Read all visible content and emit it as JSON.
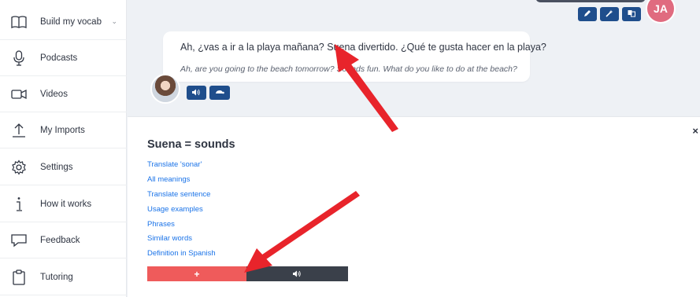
{
  "sidebar": {
    "items": [
      {
        "label": "Build my vocab",
        "icon": "book-icon"
      },
      {
        "label": "Podcasts",
        "icon": "microphone-icon"
      },
      {
        "label": "Videos",
        "icon": "video-camera-icon"
      },
      {
        "label": "My Imports",
        "icon": "upload-icon"
      },
      {
        "label": "Settings",
        "icon": "gear-icon"
      },
      {
        "label": "How it works",
        "icon": "info-icon"
      },
      {
        "label": "Feedback",
        "icon": "chat-bubble-icon"
      },
      {
        "label": "Tutoring",
        "icon": "clipboard-icon"
      }
    ]
  },
  "user": {
    "initials": "JA",
    "color": "#e06b7f"
  },
  "message": {
    "spanish": "Ah, ¿vas a ir a la playa mañana? Suena divertido. ¿Qué te gusta hacer en la playa?",
    "english": "Ah, are you going to the beach tomorrow? Sounds fun. What do you like to do at the beach?"
  },
  "popup": {
    "close": "×",
    "heading": "Suena = sounds",
    "links": [
      "Translate 'sonar'",
      "All meanings",
      "Translate sentence",
      "Usage examples",
      "Phrases",
      "Similar words",
      "Definition in Spanish"
    ],
    "add_symbol": "+"
  },
  "colors": {
    "accent_blue": "#1f4e8c",
    "add_red": "#ef5b5b",
    "audio_dark": "#3a404a",
    "link_blue": "#1a73e8",
    "arrow_red": "#e8242b"
  }
}
